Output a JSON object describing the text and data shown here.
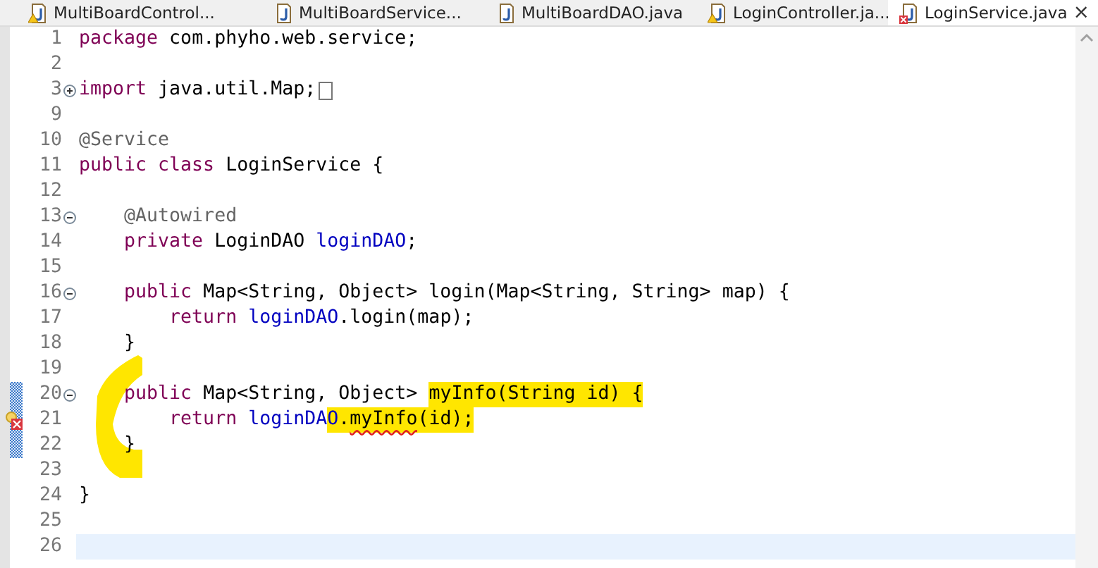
{
  "tabs": [
    {
      "label": "MultiBoardControl...",
      "selected": false,
      "warning": true,
      "error": false
    },
    {
      "label": "MultiBoardService...",
      "selected": false,
      "warning": false,
      "error": false
    },
    {
      "label": "MultiBoardDAO.java",
      "selected": false,
      "warning": false,
      "error": false
    },
    {
      "label": "LoginController.ja...",
      "selected": false,
      "warning": true,
      "error": false
    },
    {
      "label": "LoginService.java",
      "selected": true,
      "warning": false,
      "error": true
    }
  ],
  "close_glyph": "×",
  "lines": [
    {
      "number": "1",
      "tokens": [
        {
          "text": "package",
          "kind": "keyword"
        },
        {
          "text": " com.phyho.web.service;",
          "kind": "plain"
        }
      ]
    },
    {
      "number": "2"
    },
    {
      "number": "3",
      "collapsed": true,
      "folded_box": true,
      "tokens": [
        {
          "text": "import",
          "kind": "keyword"
        },
        {
          "text": " java.util.Map;",
          "kind": "plain"
        }
      ]
    },
    {
      "number": "9"
    },
    {
      "number": "10",
      "tokens": [
        {
          "text": "@Service",
          "kind": "annotation"
        }
      ]
    },
    {
      "number": "11",
      "tokens": [
        {
          "text": "public class",
          "kind": "keyword"
        },
        {
          "text": " LoginService {",
          "kind": "plain"
        }
      ]
    },
    {
      "number": "12"
    },
    {
      "number": "13",
      "collapsed": false,
      "tokens": [
        {
          "text": "    @Autowired",
          "kind": "annotation"
        }
      ]
    },
    {
      "number": "14",
      "tokens": [
        {
          "text": "    private",
          "kind": "keyword"
        },
        {
          "text": " LoginDAO ",
          "kind": "plain"
        },
        {
          "text": "loginDAO",
          "kind": "field"
        },
        {
          "text": ";",
          "kind": "plain"
        }
      ]
    },
    {
      "number": "15"
    },
    {
      "number": "16",
      "collapsed": false,
      "tokens": [
        {
          "text": "    public",
          "kind": "keyword"
        },
        {
          "text": " Map<String, Object> login(Map<String, String> map) {",
          "kind": "plain"
        }
      ]
    },
    {
      "number": "17",
      "tokens": [
        {
          "text": "        return ",
          "kind": "keyword"
        },
        {
          "text": "loginDAO",
          "kind": "field"
        },
        {
          "text": ".login(map);",
          "kind": "plain"
        }
      ]
    },
    {
      "number": "18",
      "tokens": [
        {
          "text": "    }",
          "kind": "plain"
        }
      ]
    },
    {
      "number": "19"
    },
    {
      "number": "20",
      "collapsed": false,
      "changed": true,
      "tokens": [
        {
          "text": "    public",
          "kind": "keyword",
          "highlighted": false
        },
        {
          "text": " Map<String, Object> ",
          "kind": "plain",
          "highlighted": false
        },
        {
          "text": "myInfo(String id) {",
          "kind": "plain",
          "highlighted": true
        }
      ]
    },
    {
      "number": "21",
      "changed": true,
      "error_marker": true,
      "tokens": [
        {
          "text": "        return ",
          "kind": "keyword",
          "highlighted": false
        },
        {
          "text": "loginDA",
          "kind": "field",
          "highlighted": false
        },
        {
          "text": "O",
          "kind": "field",
          "highlighted": true
        },
        {
          "text": ".",
          "kind": "plain",
          "highlighted": true
        },
        {
          "text": "myInfo",
          "kind": "plain",
          "highlighted": true,
          "error": true
        },
        {
          "text": "(id);",
          "kind": "plain",
          "highlighted": true
        }
      ]
    },
    {
      "number": "22",
      "changed": true,
      "tokens": [
        {
          "text": "    }",
          "kind": "plain"
        }
      ]
    },
    {
      "number": "23"
    },
    {
      "number": "24",
      "tokens": [
        {
          "text": "}",
          "kind": "plain"
        }
      ]
    },
    {
      "number": "25"
    },
    {
      "number": "26",
      "current": true
    }
  ],
  "marker_strokes": [
    {
      "kind": "bracket"
    }
  ]
}
